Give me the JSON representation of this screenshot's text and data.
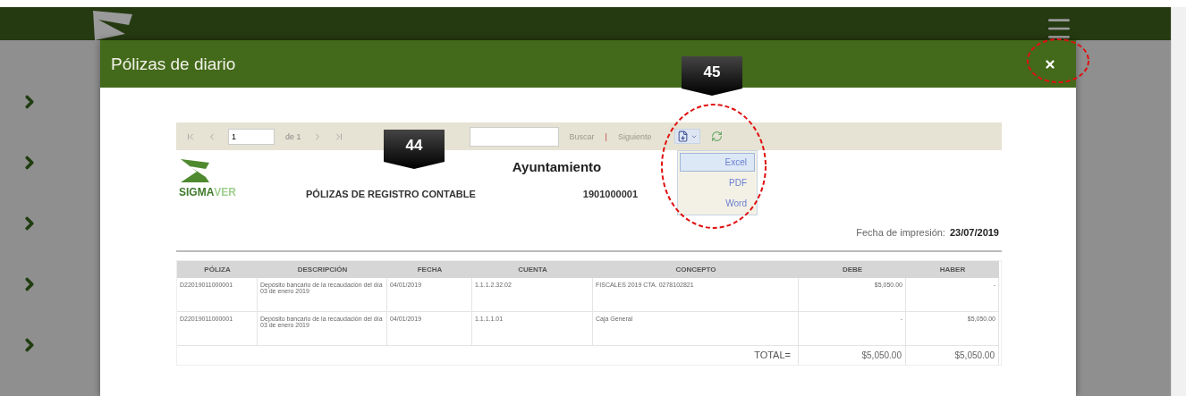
{
  "modal": {
    "title": "Pólizas de diario"
  },
  "toolbar": {
    "page_value": "1",
    "page_of": "de 1",
    "links": [
      "Buscar",
      "Siguiente"
    ],
    "separator": "|"
  },
  "export_menu": {
    "items": [
      {
        "label": "Excel",
        "selected": true
      },
      {
        "label": "PDF",
        "selected": false
      },
      {
        "label": "Word",
        "selected": false
      }
    ]
  },
  "report": {
    "logo_text": "**SIGMA**VER",
    "title": "Ayuntamiento",
    "subtitle": "PÓLIZAS DE REGISTRO CONTABLE",
    "subtitle_number": "1901000001",
    "print_label": "Fecha de impresión:",
    "print_date": "23/07/2019"
  },
  "table": {
    "columns": [
      "PÓLIZA",
      "DESCRIPCIÓN",
      "FECHA",
      "CUENTA",
      "CONCEPTO",
      "DEBE",
      "HABER"
    ],
    "rows": [
      [
        "D22019011000001",
        "Depósito bancario de la recaudación del día 03 de enero 2019",
        "04/01/2019",
        "1.1.1.2.32.02",
        "FISCALES 2019 CTA. 0278102821",
        "$5,050.00",
        "-"
      ],
      [
        "D22019011000001",
        "Depósito bancario de la recaudación del día 03 de enero 2019",
        "04/01/2019",
        "1.1.1.1.01",
        "Caja General",
        "-",
        "$5,050.00"
      ]
    ],
    "total_label": "TOTAL=",
    "totals": [
      "$5,050.00",
      "$5,050.00"
    ]
  },
  "annotations": [
    {
      "label": "44"
    },
    {
      "label": "45"
    }
  ]
}
